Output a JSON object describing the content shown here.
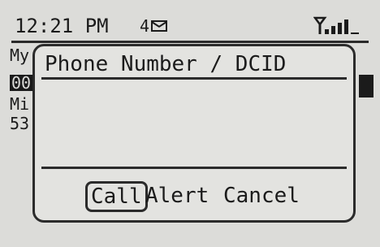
{
  "status_bar": {
    "time": "12:21 PM",
    "message_count": "4",
    "message_icon": "envelope-icon",
    "signal_icon": "signal-strength-icon"
  },
  "background": {
    "line1": "My",
    "line2": "00",
    "line3": "Mi",
    "line4": "53"
  },
  "dialog": {
    "title": "Phone Number / DCID",
    "input_value": "",
    "buttons": [
      "Call",
      "Alert",
      "Cancel"
    ],
    "selected_button": "Call"
  }
}
